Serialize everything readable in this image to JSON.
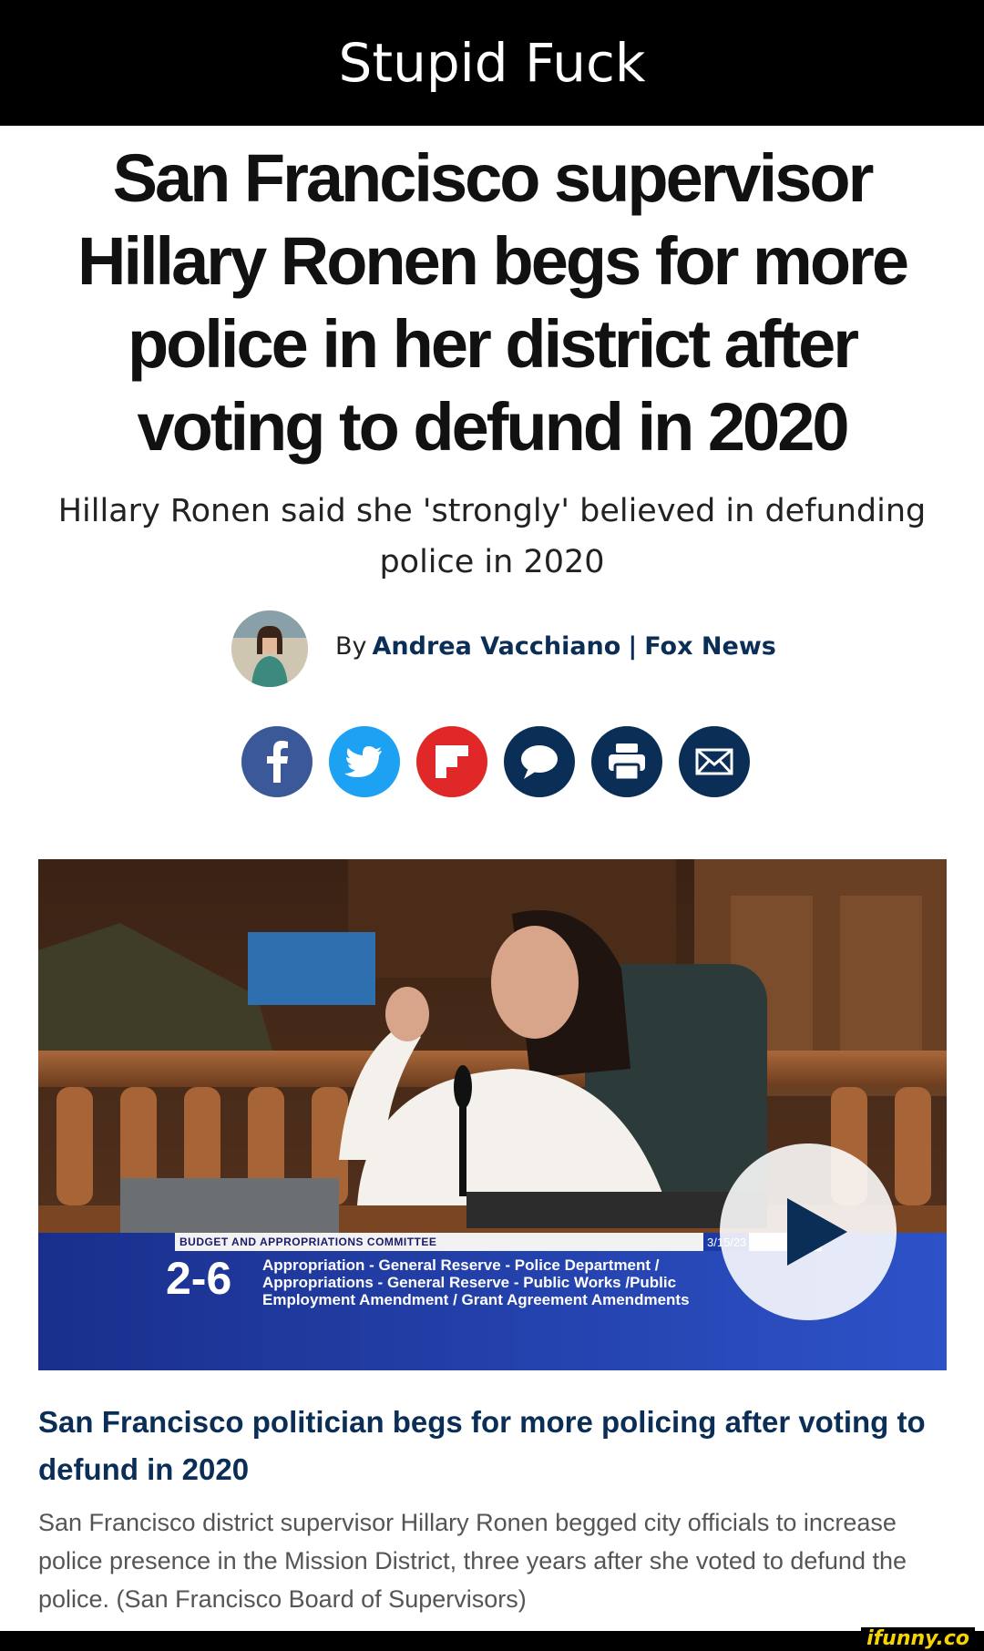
{
  "meme_caption": "Stupid Fuck",
  "article": {
    "headline": "San Francisco supervisor Hillary Ronen begs for more police in her district after voting to defund in 2020",
    "subheadline": "Hillary Ronen said she 'strongly' believed in defunding police in 2020",
    "byline": {
      "by": "By",
      "author": "Andrea Vacchiano",
      "separator": "|",
      "outlet": "Fox News"
    },
    "share_buttons": [
      {
        "name": "facebook",
        "icon": "facebook-icon",
        "color": "#3b5998"
      },
      {
        "name": "twitter",
        "icon": "twitter-bird-icon",
        "color": "#1da1f2"
      },
      {
        "name": "flipboard",
        "icon": "flipboard-icon",
        "color": "#e12828"
      },
      {
        "name": "comments",
        "icon": "speech-bubble-icon",
        "color": "#0b2e57"
      },
      {
        "name": "print",
        "icon": "printer-icon",
        "color": "#0b2e57"
      },
      {
        "name": "email",
        "icon": "envelope-icon",
        "color": "#0b2e57"
      }
    ]
  },
  "video": {
    "lower_third": {
      "committee": "Budget and Appropriations Committee",
      "item_number": "2-6",
      "date": "3/15/23",
      "line1": "Appropriation - General Reserve - Police Department /",
      "line2": "Appropriations - General Reserve - Public Works /Public",
      "line3": "Employment Amendment / Grant Agreement Amendments"
    },
    "play_icon": "play-icon",
    "caption_title": "San Francisco politician begs for more policing after voting to defund in 2020",
    "caption_body": "San Francisco district supervisor Hillary Ronen begged city officials to increase police presence in the Mission District, three years after she voted to defund the police. (San Francisco Board of Supervisors)"
  },
  "watermark": "ifunny.co"
}
